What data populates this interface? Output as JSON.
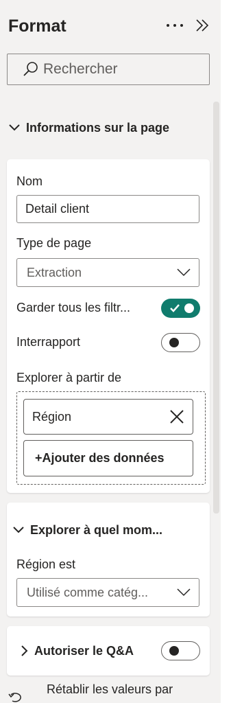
{
  "header": {
    "title": "Format",
    "more_icon": "ellipsis-icon",
    "collapse_icon": "double-chevron-right-icon"
  },
  "search": {
    "placeholder": "Rechercher"
  },
  "sections": {
    "page_info": {
      "title": "Informations sur la page",
      "name_label": "Nom",
      "name_value": "Detail client",
      "page_type_label": "Type de page",
      "page_type_value": "Extraction",
      "keep_filters_label": "Garder tous les filtr...",
      "keep_filters_on": true,
      "cross_report_label": "Interrapport",
      "cross_report_on": false,
      "drill_from_label": "Explorer à partir de",
      "drill_field": "Région",
      "add_data_label": "+Ajouter des données"
    },
    "drill_when": {
      "title": "Explorer à quel mom...",
      "region_label": "Région est",
      "region_value": "Utilisé comme catég..."
    },
    "qa": {
      "title": "Autoriser le Q&A",
      "enabled": false
    }
  },
  "footer": {
    "reset_label": "Rétablir les valeurs par"
  },
  "colors": {
    "toggle_on": "#107c6d",
    "panel_bg": "#f3f2f1",
    "card_bg": "#ffffff"
  }
}
